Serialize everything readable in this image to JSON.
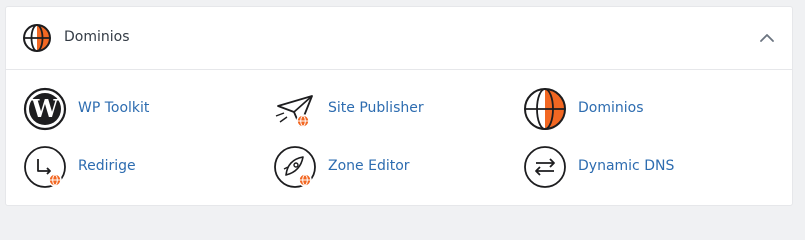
{
  "header": {
    "title": "Dominios",
    "icon": "globe-icon"
  },
  "colors": {
    "accent_orange": "#f26722",
    "link_blue": "#2d6cb0",
    "icon_dark": "#1d1d1f"
  },
  "items": [
    {
      "label": "WP Toolkit",
      "icon": "wordpress-icon"
    },
    {
      "label": "Site Publisher",
      "icon": "paper-plane-icon"
    },
    {
      "label": "Dominios",
      "icon": "globe-icon"
    },
    {
      "label": "Redirige",
      "icon": "redirect-icon"
    },
    {
      "label": "Zone Editor",
      "icon": "rocket-icon"
    },
    {
      "label": "Dynamic DNS",
      "icon": "swap-arrows-icon"
    }
  ]
}
